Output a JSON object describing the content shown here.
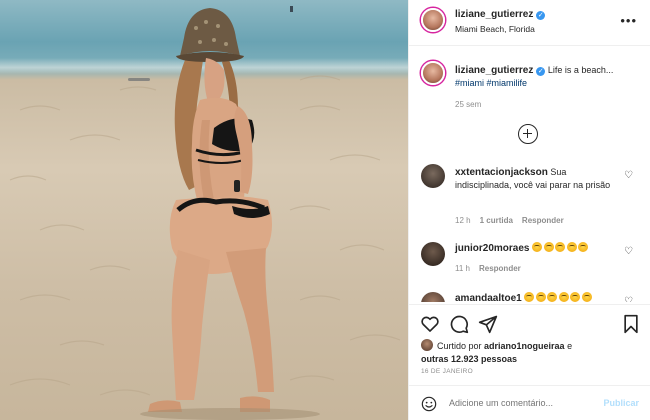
{
  "post": {
    "username": "liziane_gutierrez",
    "location": "Miami Beach, Florida",
    "caption_user": "liziane_gutierrez",
    "caption_text": " Life is a beach...",
    "hashtag1": "#miami",
    "hashtag2": "#miamilife",
    "caption_time": "25 sem",
    "more_icon": "more-horizontal-icon"
  },
  "comments": [
    {
      "username": "xxtentacionjackson",
      "text": " Sua indisciplinada, você vai parar na prisão",
      "time": "12 h",
      "likes": "1 curtida",
      "reply": "Responder"
    },
    {
      "username": "junior20moraes",
      "text": "",
      "time": "11 h",
      "reply": "Responder"
    },
    {
      "username": "amandaaltoe1",
      "text": ""
    }
  ],
  "actions": {
    "liked_by_prefix": "Curtido por ",
    "liked_by_user": "adriano1nogueiraa",
    "liked_by_mid": " e ",
    "liked_by_others": "outras 12.923 pessoas",
    "date": "16 DE JANEIRO"
  },
  "composer": {
    "placeholder": "Adicione um comentário...",
    "post_label": "Publicar"
  },
  "colors": {
    "verified": "#3897f0",
    "hashtag": "#00376b",
    "post_button": "#b2dffc"
  }
}
